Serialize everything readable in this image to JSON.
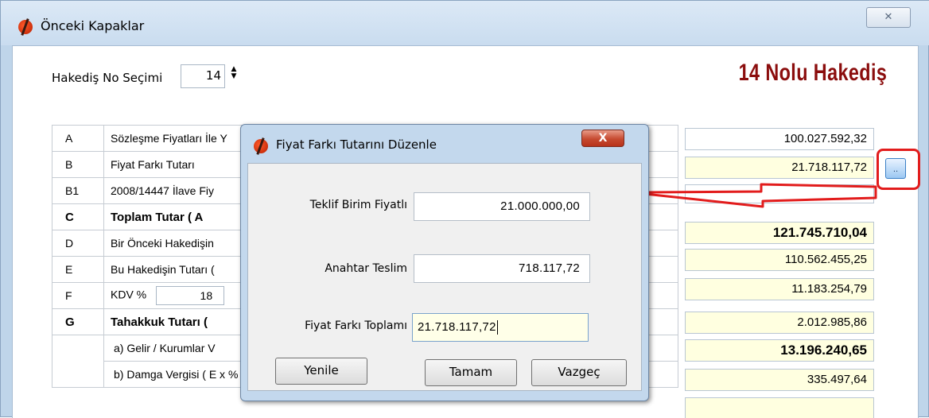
{
  "window": {
    "title": "Önceki Kapaklar",
    "close_glyph": "✕"
  },
  "hakedis": {
    "label": "Hakediş No Seçimi",
    "value": "14",
    "spin_up": "▲",
    "spin_down": "▼"
  },
  "heading": "14 Nolu Hakediş",
  "rows": [
    {
      "code": "A",
      "label": "Sözleşme Fiyatları İle Y",
      "value": "100.027.592,32"
    },
    {
      "code": "B",
      "label": "Fiyat Farkı Tutarı",
      "value": "21.718.117,72"
    },
    {
      "code": "B1",
      "label": "2008/14447 İlave Fiy",
      "value": ""
    },
    {
      "code": "C",
      "label": "Toplam Tutar   ( A",
      "value": "121.745.710,04"
    },
    {
      "code": "D",
      "label": "Bir Önceki Hakedişin",
      "value": "110.562.455,25"
    },
    {
      "code": "E",
      "label": "Bu Hakedişin Tutarı (",
      "value": "11.183.254,79"
    },
    {
      "code": "F",
      "label": "KDV %",
      "kdv": "18",
      "value": "2.012.985,86"
    },
    {
      "code": "G",
      "label": "Tahakkuk Tutarı (",
      "value": "13.196.240,65"
    },
    {
      "code": "",
      "label": "a) Gelir / Kurumlar V",
      "value": "335.497,64"
    },
    {
      "code": "",
      "label": "b) Damga Vergisi  ( E x %",
      "value": ""
    }
  ],
  "side_button": "..",
  "dialog": {
    "title": "Fiyat Farkı Tutarını Düzenle",
    "close_glyph": "X",
    "fields": [
      {
        "label": "Teklif Birim Fiyatlı",
        "value": "21.000.000,00"
      },
      {
        "label": "Anahtar Teslim",
        "value": "718.117,72"
      },
      {
        "label": "Fiyat Farkı Toplamı",
        "value": "21.718.117,72"
      }
    ],
    "buttons": {
      "refresh": "Yenile",
      "ok": "Tamam",
      "cancel": "Vazgeç"
    }
  },
  "colors": {
    "heading": "#8b0d0d",
    "highlight_box": "#e21c1c",
    "arrow": "#e21c1c",
    "value_bg": "#ffffe0"
  }
}
